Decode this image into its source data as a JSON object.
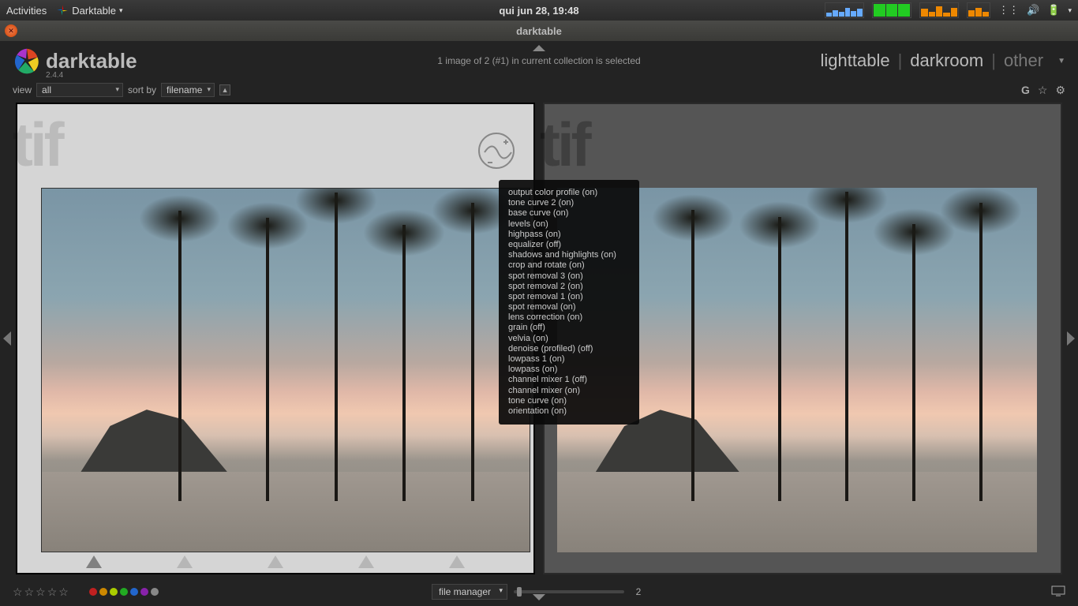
{
  "topbar": {
    "activities": "Activities",
    "app_menu": "Darktable",
    "datetime": "qui jun 28, 19:48"
  },
  "window": {
    "title": "darktable"
  },
  "header": {
    "app_name": "darktable",
    "version": "2.4.4",
    "status": "1 image of 2 (#1) in current collection is selected",
    "modes": {
      "lighttable": "lighttable",
      "darkroom": "darkroom",
      "other": "other"
    }
  },
  "filterbar": {
    "view_label": "view",
    "view_value": "all",
    "sort_label": "sort by",
    "sort_value": "filename",
    "grouping": "G"
  },
  "thumbs": {
    "watermark": "tif"
  },
  "history_tooltip": [
    "output color profile (on)",
    "tone curve 2 (on)",
    "base curve (on)",
    "levels (on)",
    "highpass (on)",
    "equalizer (off)",
    "shadows and highlights (on)",
    "crop and rotate (on)",
    "spot removal 3 (on)",
    "spot removal 2 (on)",
    "spot removal 1 (on)",
    "spot removal (on)",
    "lens correction (on)",
    "grain (off)",
    "velvia (on)",
    "denoise (profiled) (off)",
    "lowpass 1 (on)",
    "lowpass (on)",
    "channel mixer 1 (off)",
    "channel mixer (on)",
    "tone curve (on)",
    "orientation (on)"
  ],
  "footer": {
    "layout_mode": "file manager",
    "zoom_value": "2",
    "color_labels": [
      "#c02020",
      "#cc8800",
      "#aacc00",
      "#22aa22",
      "#2266cc",
      "#8822aa",
      "#888888"
    ]
  }
}
